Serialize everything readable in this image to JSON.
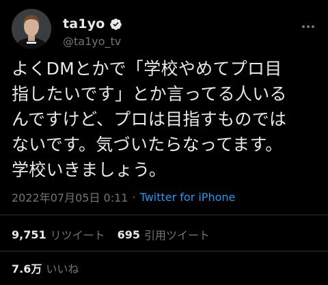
{
  "user": {
    "display_name": "ta1yo",
    "handle": "@ta1yo_tv",
    "verified_icon": "verified-badge-icon",
    "avatar_icon": "profile-avatar"
  },
  "tweet": {
    "text": "よくDMとかで「学校やめてプロ目\n指したいです」とか言ってる人いる\nんですけど、プロは目指すものでは\nないです。気づいたらなってます。\n学校いきましょう。",
    "timestamp": "2022年07月05日 0:11",
    "separator": "·",
    "source": "Twitter for iPhone"
  },
  "stats": {
    "retweets_count": "9,751",
    "retweets_label": "リツイート",
    "quotes_count": "695",
    "quotes_label": "引用ツイート",
    "likes_count": "7.6万",
    "likes_label": "いいね"
  },
  "colors": {
    "background": "#000000",
    "text": "#e7e9ea",
    "secondary": "#71767b",
    "link": "#1d9bf0",
    "divider": "#2f3336"
  }
}
